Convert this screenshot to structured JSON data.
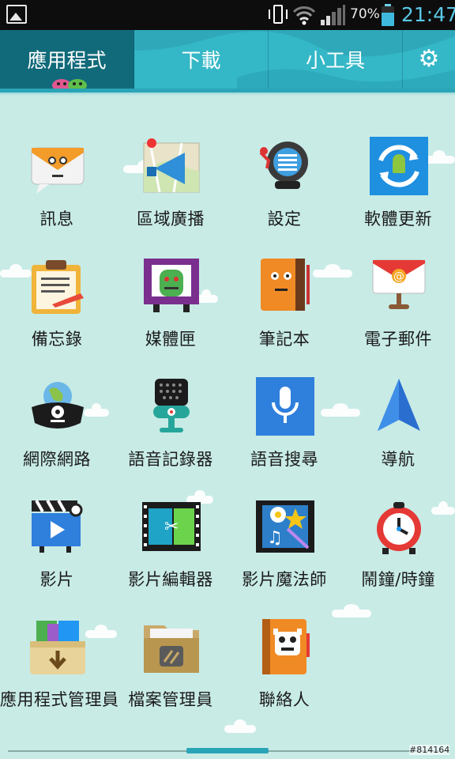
{
  "status_bar": {
    "battery_percent": "70%",
    "time": "21:47",
    "icons": [
      "gallery-icon",
      "vibrate-icon",
      "wifi-icon",
      "signal-icon",
      "battery-icon"
    ]
  },
  "tabs": [
    {
      "label": "應用程式",
      "active": true
    },
    {
      "label": "下載",
      "active": false
    },
    {
      "label": "小工具",
      "active": false
    }
  ],
  "settings_icon": "gear-icon",
  "apps": [
    {
      "label": "訊息",
      "icon": "message-icon"
    },
    {
      "label": "區域廣播",
      "icon": "area-broadcast-icon"
    },
    {
      "label": "設定",
      "icon": "settings-robot-icon"
    },
    {
      "label": "軟體更新",
      "icon": "software-update-icon"
    },
    {
      "label": "備忘錄",
      "icon": "memo-icon"
    },
    {
      "label": "媒體匣",
      "icon": "media-box-icon"
    },
    {
      "label": "筆記本",
      "icon": "notebook-icon"
    },
    {
      "label": "電子郵件",
      "icon": "email-icon"
    },
    {
      "label": "網際網路",
      "icon": "internet-icon"
    },
    {
      "label": "語音記錄器",
      "icon": "voice-recorder-icon"
    },
    {
      "label": "語音搜尋",
      "icon": "voice-search-icon"
    },
    {
      "label": "導航",
      "icon": "navigation-icon"
    },
    {
      "label": "影片",
      "icon": "video-icon"
    },
    {
      "label": "影片編輯器",
      "icon": "video-editor-icon"
    },
    {
      "label": "影片魔法師",
      "icon": "video-wiz-icon"
    },
    {
      "label": "鬧鐘/時鐘",
      "icon": "alarm-clock-icon"
    },
    {
      "label": "應用程式管理員",
      "icon": "app-manager-icon"
    },
    {
      "label": "檔案管理員",
      "icon": "file-manager-icon"
    },
    {
      "label": "聯絡人",
      "icon": "contacts-icon"
    }
  ],
  "page_indicator": {
    "current": 1
  },
  "watermark": "#814164",
  "colors": {
    "background": "#c8ebe6",
    "tab_bar": "#34b7c7",
    "tab_active": "#116a7a",
    "clock_text": "#5ac8e6"
  }
}
